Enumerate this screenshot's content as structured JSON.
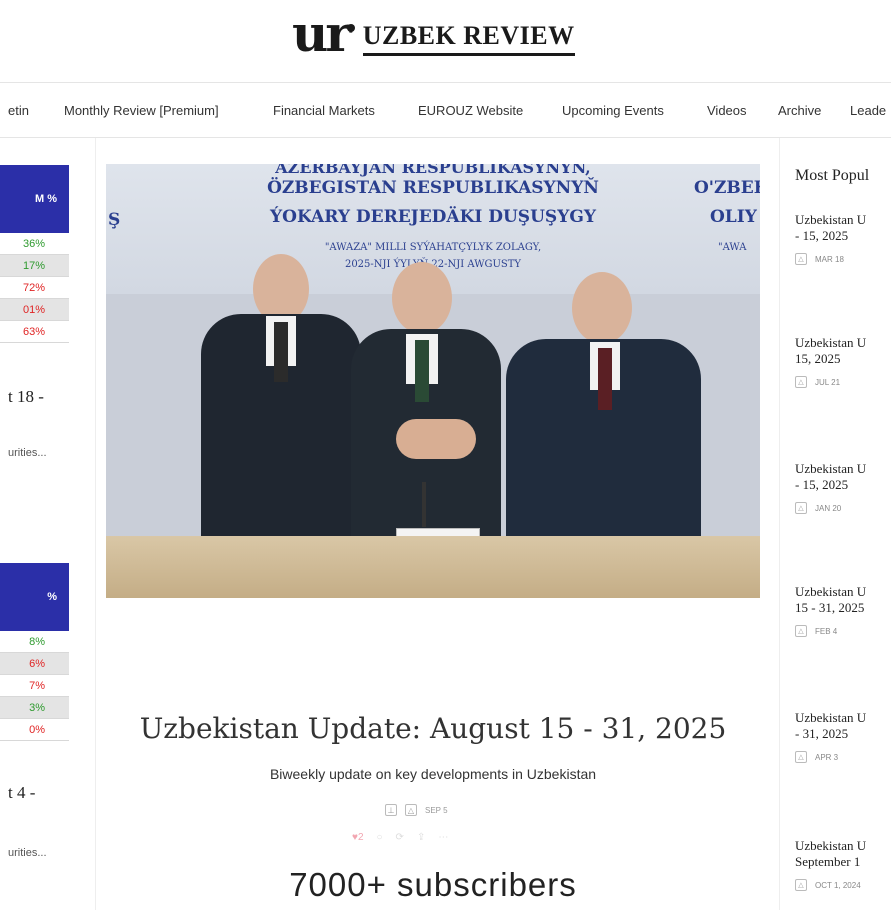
{
  "brand": {
    "logo_mark": "ur",
    "name": "UZBEK REVIEW"
  },
  "nav": [
    "etin",
    "Monthly Review [Premium]",
    "Financial Markets",
    "EUROUZ Website",
    "Upcoming Events",
    "Videos",
    "Archive",
    "Leade"
  ],
  "left_cards": [
    {
      "header": "M %",
      "rows": [
        "36%",
        "17%",
        "72%",
        "01%",
        "63%"
      ],
      "title": "t 18 -",
      "desc": "urities..."
    },
    {
      "header": "%",
      "rows": [
        "8%",
        "6%",
        "7%",
        "3%",
        "0%"
      ],
      "title": "t 4 -",
      "desc": "urities..."
    }
  ],
  "hero_banner": {
    "line1": "AZERBAÝJAN RESPUBLIKASYNYŇ,",
    "line2": "ÖZBEGISTAN RESPUBLIKASYNYŇ",
    "line3": "ÝOKARY DEREJEDÄKI DUŞUŞYGY",
    "line4": "\"AWAZA\" MILLI SYÝAHATÇYLYK ZOLAGY,",
    "line5": "2025-NJI ÝYLYŇ 22-NJI AWGUSTY",
    "left_glyph": "Ş",
    "right_line1": "O'ZBEK",
    "right_line2": "OLIY I",
    "right_line3": "\"AWA"
  },
  "article": {
    "title": "Uzbekistan Update: August 15 - 31, 2025",
    "subtitle": "Biweekly update on key developments in Uzbekistan",
    "date": "SEP 5",
    "likes": "2"
  },
  "subscribers": "7000+ subscribers",
  "most_popular": {
    "heading": "Most Popul",
    "items": [
      {
        "line1": "Uzbekistan U",
        "line2": "- 15, 2025",
        "date": "MAR 18"
      },
      {
        "line1": "Uzbekistan U",
        "line2": "15, 2025",
        "date": "JUL 21"
      },
      {
        "line1": "Uzbekistan U",
        "line2": "- 15, 2025",
        "date": "JAN 20"
      },
      {
        "line1": "Uzbekistan U",
        "line2": "15 - 31, 2025",
        "date": "FEB 4"
      },
      {
        "line1": "Uzbekistan U",
        "line2": "- 31, 2025",
        "date": "APR 3"
      },
      {
        "line1": "Uzbekistan U",
        "line2": "September 1",
        "date": "OCT 1, 2024"
      }
    ]
  },
  "colors": {
    "accent": "#2b2fa8",
    "positive": "#2e9a2e",
    "negative": "#e02424"
  },
  "icons": {
    "lock": "lock-icon",
    "pin": "pin-icon",
    "heart": "heart-icon",
    "comment": "comment-icon",
    "restack": "restack-icon",
    "share": "share-icon",
    "more": "more-icon"
  }
}
